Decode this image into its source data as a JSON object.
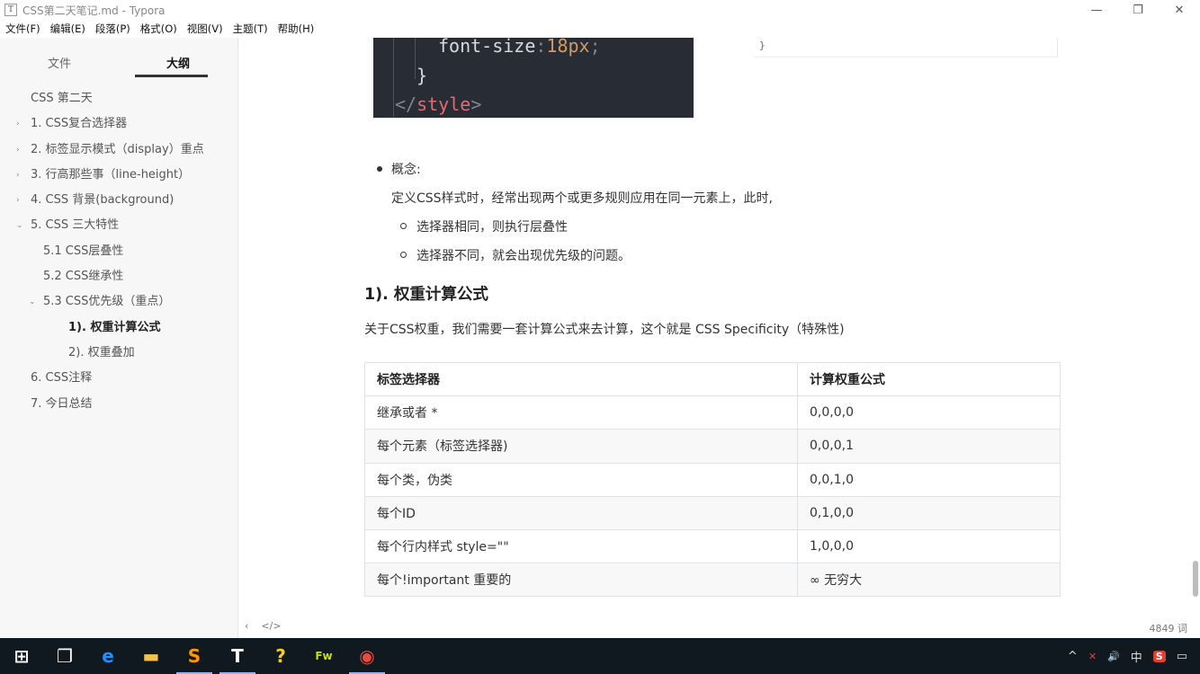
{
  "window": {
    "title": "CSS第二天笔记.md - Typora",
    "app_icon": "T",
    "minimize": "—",
    "restore": "❐",
    "close": "✕"
  },
  "menu": [
    "文件(F)",
    "编辑(E)",
    "段落(P)",
    "格式(O)",
    "视图(V)",
    "主题(T)",
    "帮助(H)"
  ],
  "sidebar": {
    "tabs": [
      "文件",
      "大纲"
    ],
    "active_tab": "大纲",
    "outline": [
      {
        "label": "CSS 第二天",
        "level": 1,
        "caret": ""
      },
      {
        "label": "1. CSS复合选择器",
        "level": 1,
        "caret": "›"
      },
      {
        "label": "2. 标签显示模式（display）重点",
        "level": 1,
        "caret": "›"
      },
      {
        "label": "3. 行高那些事（line-height）",
        "level": 1,
        "caret": "›"
      },
      {
        "label": "4. CSS 背景(background)",
        "level": 1,
        "caret": "›"
      },
      {
        "label": "5. CSS 三大特性",
        "level": 1,
        "caret": "⌄"
      },
      {
        "label": "5.1 CSS层叠性",
        "level": 2,
        "caret": ""
      },
      {
        "label": "5.2 CSS继承性",
        "level": 2,
        "caret": ""
      },
      {
        "label": "5.3 CSS优先级（重点）",
        "level": 2,
        "caret": "⌄"
      },
      {
        "label": "1). 权重计算公式",
        "level": 3,
        "caret": "",
        "active": true
      },
      {
        "label": "2). 权重叠加",
        "level": 3,
        "caret": ""
      },
      {
        "label": "6. CSS注释",
        "level": 1,
        "caret": ""
      },
      {
        "label": "7. 今日总结",
        "level": 1,
        "caret": ""
      }
    ]
  },
  "code": {
    "line1_prop": "font-size",
    "line1_colon": ":",
    "line1_num": "18px",
    "line1_semi": ";",
    "line2": "}",
    "line3_open": "</",
    "line3_tag": "style",
    "line3_close": ">",
    "right_snippet": "}"
  },
  "content": {
    "concept_label": "概念:",
    "concept_text": "定义CSS样式时，经常出现两个或更多规则应用在同一元素上，此时,",
    "sub_items": [
      "选择器相同，则执行层叠性",
      "选择器不同，就会出现优先级的问题。"
    ],
    "heading": "1). 权重计算公式",
    "paragraph": "关于CSS权重，我们需要一套计算公式来去计算，这个就是 CSS Specificity（特殊性)",
    "table": {
      "headers": [
        "标签选择器",
        "计算权重公式"
      ],
      "rows": [
        [
          "继承或者 *",
          "0,0,0,0"
        ],
        [
          "每个元素（标签选择器)",
          "0,0,0,1"
        ],
        [
          "每个类，伪类",
          "0,0,1,0"
        ],
        [
          "每个ID",
          "0,1,0,0"
        ],
        [
          "每个行内样式 style=\"\"",
          "1,0,0,0"
        ],
        [
          "每个!important  重要的",
          "∞ 无穷大"
        ]
      ]
    }
  },
  "status": {
    "back": "‹",
    "source": "</>",
    "word_count": "4849 词"
  },
  "taskbar": {
    "apps": [
      {
        "name": "windows-start-icon",
        "glyph": "⊞",
        "color": "#ffffff",
        "open": false
      },
      {
        "name": "task-view-icon",
        "glyph": "❐",
        "color": "#ffffff",
        "open": false
      },
      {
        "name": "edge-icon",
        "glyph": "e",
        "color": "#1e90ff",
        "open": false
      },
      {
        "name": "file-explorer-icon",
        "glyph": "▬",
        "color": "#f2c14e",
        "open": false
      },
      {
        "name": "sublime-icon",
        "glyph": "S",
        "color": "#ff9800",
        "open": true
      },
      {
        "name": "typora-icon",
        "glyph": "T",
        "color": "#ffffff",
        "open": true
      },
      {
        "name": "help-icon",
        "glyph": "?",
        "color": "#f2d024",
        "open": false
      },
      {
        "name": "fireworks-icon",
        "glyph": "Fw",
        "color": "#c8e000",
        "open": false
      },
      {
        "name": "chrome-icon",
        "glyph": "◉",
        "color": "#e74c3c",
        "open": true
      }
    ],
    "tray": {
      "chevron": "^",
      "network": "✕",
      "volume": "🔊",
      "ime": "中",
      "sogou": "S",
      "notifications": "▭"
    }
  }
}
